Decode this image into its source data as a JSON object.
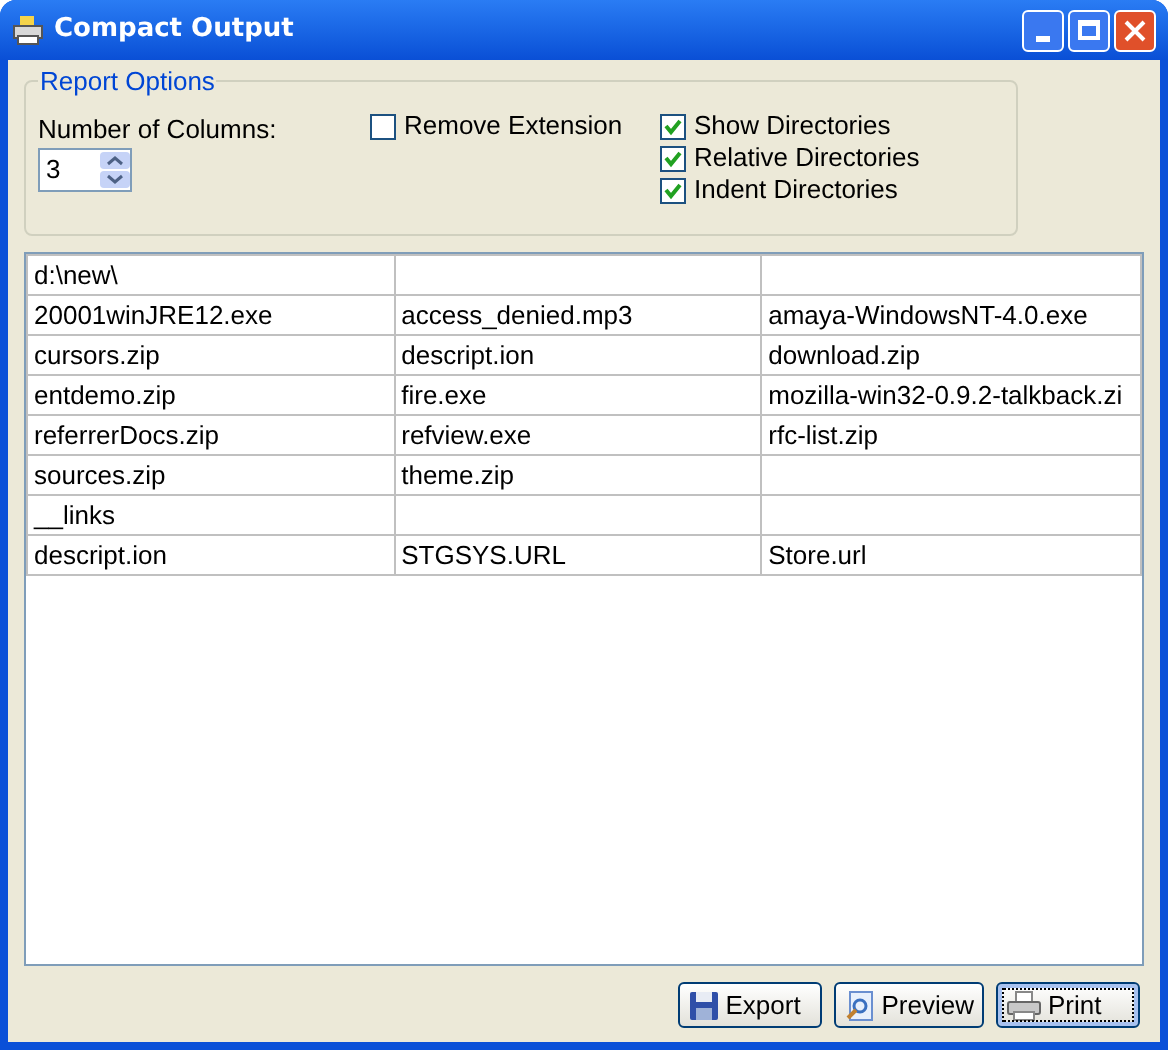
{
  "window": {
    "title": "Compact Output"
  },
  "report_options": {
    "title": "Report Options",
    "columns_label": "Number of Columns:",
    "columns_value": "3",
    "checkboxes": [
      {
        "label": "Remove Extension",
        "checked": false
      },
      {
        "label": "Show Directories",
        "checked": true
      },
      {
        "label": "Relative Directories",
        "checked": true
      },
      {
        "label": "Indent Directories",
        "checked": true
      }
    ]
  },
  "table": {
    "rows": [
      [
        "d:\\new\\"
      ],
      [
        "20001winJRE12.exe",
        "access_denied.mp3",
        "amaya-WindowsNT-4.0.exe"
      ],
      [
        "cursors.zip",
        "descript.ion",
        "download.zip"
      ],
      [
        "entdemo.zip",
        "fire.exe",
        "mozilla-win32-0.9.2-talkback.zi"
      ],
      [
        "referrerDocs.zip",
        "refview.exe",
        "rfc-list.zip"
      ],
      [
        "sources.zip",
        "theme.zip"
      ],
      [
        "__links"
      ],
      [
        "descript.ion",
        "STGSYS.URL",
        "Store.url"
      ]
    ]
  },
  "buttons": [
    {
      "label": "Export",
      "kind": "save",
      "focused": false
    },
    {
      "label": "Preview",
      "kind": "preview",
      "focused": false
    },
    {
      "label": "Print",
      "kind": "print",
      "focused": true
    }
  ]
}
